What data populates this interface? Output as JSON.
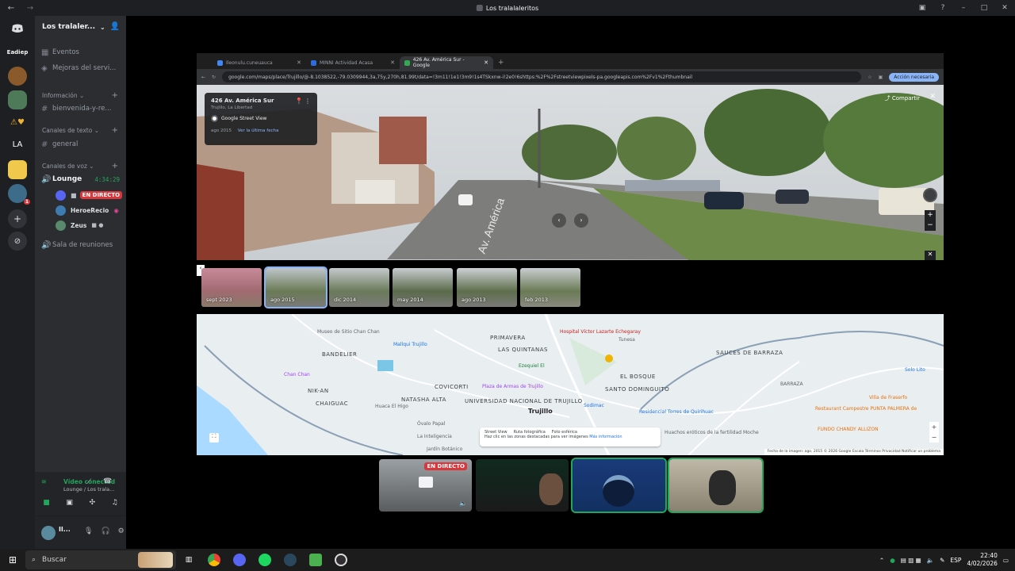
{
  "window": {
    "title": "Los tralalaleritos"
  },
  "servers": {
    "folder_label": "Eadiep",
    "la_label": "LA",
    "badge": "1"
  },
  "guild": {
    "name": "Los tralaler...",
    "items": [
      {
        "label": "Eventos"
      },
      {
        "label": "Mejoras del servi..."
      }
    ],
    "cat_info": "Información",
    "ch_bienvenida": "bienvenida-y-re...",
    "cat_text": "Canales de texto",
    "ch_general": "general",
    "cat_voice": "Canales de voz",
    "ch_lounge": "Lounge",
    "lounge_timer": "4:34:29",
    "voice_users": [
      {
        "name": "",
        "live": "EN DIRECTO"
      },
      {
        "name": "HeroeRecio"
      },
      {
        "name": "Zeus"
      }
    ],
    "ch_sala": "Sala de reuniones"
  },
  "voice_panel": {
    "status": "Vídeo conectad",
    "sub": "Lounge / Los trala..."
  },
  "user_panel": {
    "name": "Il..."
  },
  "browser": {
    "tabs": [
      {
        "label": "Ileonulu.cuneuauca"
      },
      {
        "label": "MINNI Actividad Acasa"
      },
      {
        "label": "426 Av. América Sur - Google"
      }
    ],
    "url": "google.com/maps/place/Trujillo/@-8.1038522,-79.0309944,3a,75y,270h,81.99t/data=!3m11!1e1!3m9!1s4TSkxnw-i!2e0!6shttps:%2F%2Fstreetviewpixels-pa.googleapis.com%2Fv1%2Fthumbnail",
    "action": "Acción necesaria"
  },
  "streetview": {
    "address": "426 Av. América Sur",
    "locality": "Trujillo, La Libertad",
    "source": "Google Street View",
    "date": "ago 2015",
    "latest": "Ver la última fecha",
    "share": "Compartir",
    "thumbs": [
      "sept 2023",
      "ago 2015",
      "dic 2014",
      "may 2014",
      "ago 2013",
      "feb 2013"
    ]
  },
  "map": {
    "labels": [
      {
        "text": "Museo de Sitio Chan Chan",
        "cls": ""
      },
      {
        "text": "Mallqui Trujillo",
        "cls": ""
      },
      {
        "text": "PRIMAVERA",
        "cls": "big"
      },
      {
        "text": "LAS QUINTANAS",
        "cls": "big"
      },
      {
        "text": "Hospital Víctor Lazarte Echegaray",
        "cls": ""
      },
      {
        "text": "BANDELIER",
        "cls": "big"
      },
      {
        "text": "Chan Chan",
        "cls": ""
      },
      {
        "text": "Tunesa",
        "cls": ""
      },
      {
        "text": "SAUCES DE BARRAZA",
        "cls": "big"
      },
      {
        "text": "EL BOSQUE",
        "cls": "big"
      },
      {
        "text": "NIK-AN",
        "cls": "big"
      },
      {
        "text": "CHAIGUAC",
        "cls": "big"
      },
      {
        "text": "COVICORTI",
        "cls": "big"
      },
      {
        "text": "SANTO DOMINGUITO",
        "cls": "big"
      },
      {
        "text": "Plaza de Armas de Trujillo",
        "cls": ""
      },
      {
        "text": "NATASHA ALTA",
        "cls": "big"
      },
      {
        "text": "UNIVERSIDAD NACIONAL DE TRUJILLO",
        "cls": "big"
      },
      {
        "text": "Trujillo",
        "cls": "city"
      },
      {
        "text": "Huaca El Higo",
        "cls": ""
      },
      {
        "text": "Sodimac",
        "cls": ""
      },
      {
        "text": "Residencial Torres de Quirihuac",
        "cls": ""
      },
      {
        "text": "Óvalo Papal",
        "cls": ""
      },
      {
        "text": "La Inteligencia",
        "cls": ""
      },
      {
        "text": "Jardín Botánico",
        "cls": ""
      },
      {
        "text": "Restaurant Campestre PUNTA PALMERA de",
        "cls": ""
      },
      {
        "text": "Villa de Fraserfo",
        "cls": ""
      },
      {
        "text": "Solo Lito",
        "cls": ""
      },
      {
        "text": "FUNDO CHANDY ALLIZON",
        "cls": ""
      },
      {
        "text": "Huachos eróticos de la fertilidad Moche",
        "cls": ""
      },
      {
        "text": "BARRAZA",
        "cls": ""
      },
      {
        "text": "Ezequiel El",
        "cls": ""
      }
    ],
    "legend_a": "Street View",
    "legend_b": "Ruta fotográfica",
    "legend_c": "Foto esférica",
    "legend_note": "Haz clic en las zonas destacadas para ver imágenes",
    "legend_more": "Más información",
    "footer": "Fecha de la imagen: ago. 2015   © 2026 Google   Escala   Términos   Privacidad   Notificar un problema"
  },
  "stream": {
    "live": "EN DIRECTO"
  },
  "taskbar": {
    "search": "Buscar",
    "lang": "ESP",
    "time": "22:40",
    "date": "4/02/2026"
  }
}
